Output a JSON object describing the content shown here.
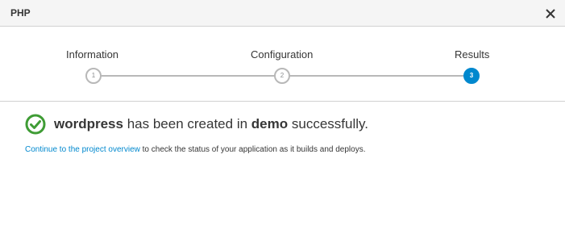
{
  "dialog": {
    "title": "PHP",
    "close_icon": "close-icon"
  },
  "wizard": {
    "steps": [
      {
        "label": "Information",
        "number": "1",
        "state": "complete"
      },
      {
        "label": "Configuration",
        "number": "2",
        "state": "complete"
      },
      {
        "label": "Results",
        "number": "3",
        "state": "active"
      }
    ],
    "active_color": "#0088ce"
  },
  "result": {
    "icon": "check-circle-icon",
    "icon_color": "#3f9c35",
    "app_name": "wordpress",
    "middle_text": "has been created in",
    "project_name": "demo",
    "end_text": "successfully."
  },
  "info": {
    "link_text": "Continue to the project overview",
    "rest_text": "to check the status of your application as it builds and deploys."
  }
}
